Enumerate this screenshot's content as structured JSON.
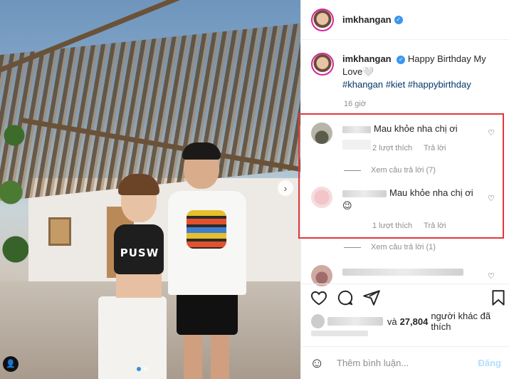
{
  "post": {
    "username": "imkhangan",
    "caption_text": "Happy Birthday My Love🤍",
    "hashtags": "#khangan #kiet #happybirthday",
    "time": "16 giờ",
    "photo_shirt_text": "PUSW"
  },
  "comments": [
    {
      "text": "Mau khỏe nha chị ơi",
      "likes": "2 lượt thích",
      "reply": "Trả lời",
      "view_replies": "Xem câu trả lời (7)"
    },
    {
      "text": "Mau khỏe nha chị ơi",
      "emoji": "😉",
      "likes": "1 lượt thích",
      "reply": "Trả lời",
      "view_replies": "Xem câu trả lời (1)"
    }
  ],
  "likes_summary": {
    "connector": "và",
    "count": "27,804",
    "suffix": "người khác đã thích"
  },
  "comment_box": {
    "placeholder": "Thêm bình luận...",
    "post_label": "Đăng"
  },
  "colors": {
    "highlight": "#e0383e",
    "link": "#00376b",
    "verified": "#3897f0",
    "post_disabled": "#b2dffc"
  }
}
